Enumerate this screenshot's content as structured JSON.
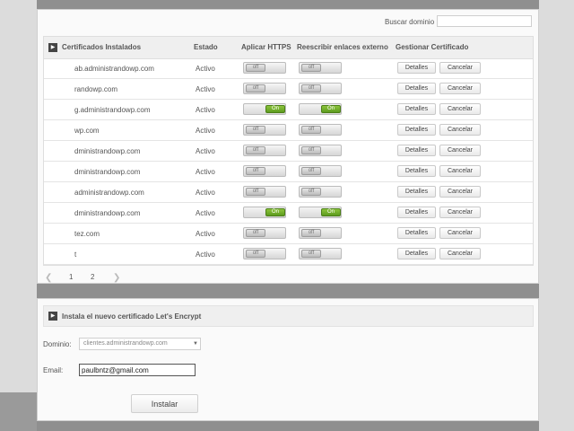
{
  "search": {
    "label": "Buscar dominio",
    "value": ""
  },
  "table": {
    "headers": {
      "cert": "Certificados Instalados",
      "status": "Estado",
      "https": "Aplicar HTTPS",
      "rewrite": "Reescribir enlaces externo",
      "manage": "Gestionar Certificado"
    },
    "rows": [
      {
        "domain": "ab.administrandowp.com",
        "status": "Activo",
        "https": "off",
        "rewrite": "off"
      },
      {
        "domain": "randowp.com",
        "status": "Activo",
        "https": "off",
        "rewrite": "off"
      },
      {
        "domain": "g.administrandowp.com",
        "status": "Activo",
        "https": "on",
        "rewrite": "on"
      },
      {
        "domain": "wp.com",
        "status": "Activo",
        "https": "off",
        "rewrite": "off"
      },
      {
        "domain": "dministrandowp.com",
        "status": "Activo",
        "https": "off",
        "rewrite": "off"
      },
      {
        "domain": "dministrandowp.com",
        "status": "Activo",
        "https": "off",
        "rewrite": "off"
      },
      {
        "domain": "administrandowp.com",
        "status": "Activo",
        "https": "off",
        "rewrite": "off"
      },
      {
        "domain": "dministrandowp.com",
        "status": "Activo",
        "https": "on",
        "rewrite": "on"
      },
      {
        "domain": "tez.com",
        "status": "Activo",
        "https": "off",
        "rewrite": "off"
      },
      {
        "domain": "t",
        "status": "Activo",
        "https": "off",
        "rewrite": "off"
      }
    ],
    "switch_labels": {
      "off": "off",
      "on": "On"
    },
    "details_label": "Detalles",
    "cancel_label": "Cancelar"
  },
  "pager": {
    "prev": "❮",
    "next": "❯",
    "pages": [
      "1",
      "2"
    ]
  },
  "install": {
    "title": "Instala el nuevo certificado Let's Encrypt",
    "domain_label": "Dominio:",
    "domain_value": "clientes.administrandowp.com",
    "email_label": "Email:",
    "email_value": "paulbntz@gmail.com",
    "button": "Instalar"
  }
}
